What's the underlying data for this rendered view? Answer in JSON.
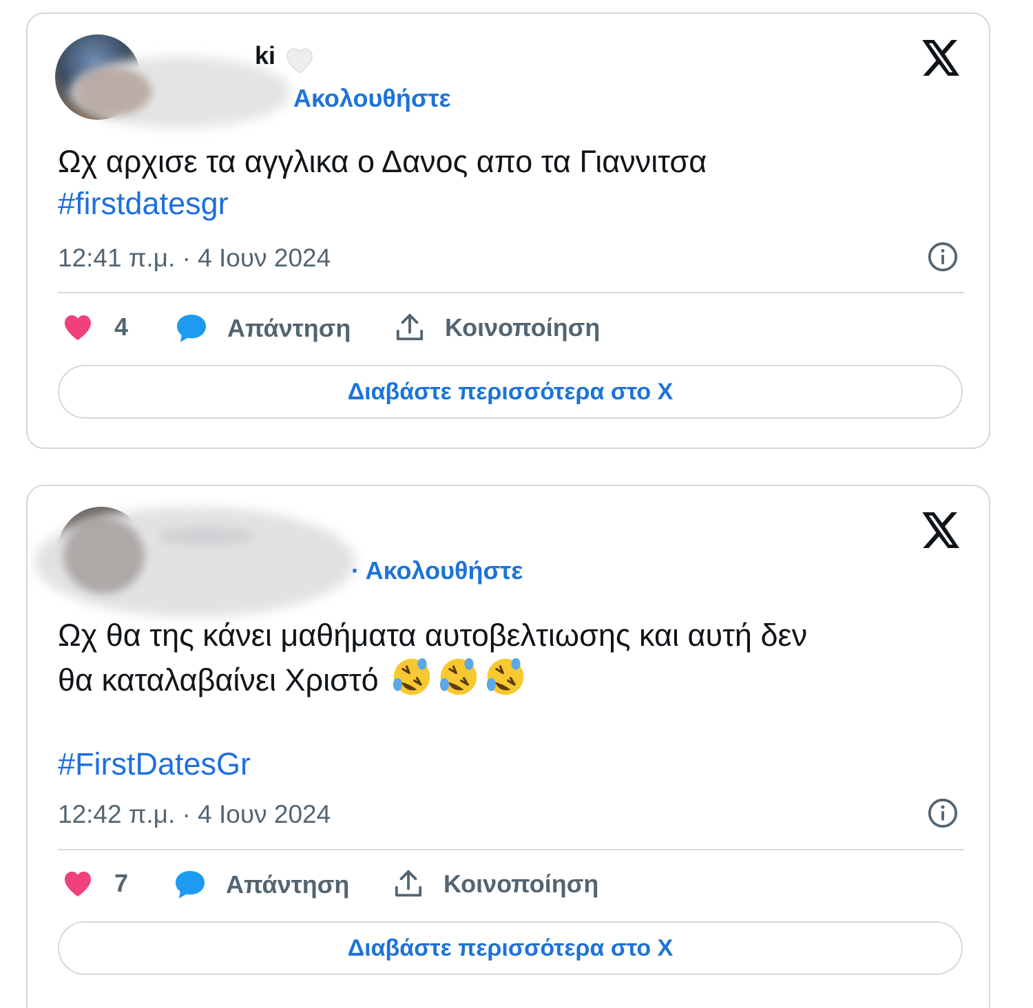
{
  "tweets": [
    {
      "name_partial": "ki",
      "follow_label": "Ακολουθήστε",
      "text_lines": [
        "Ωχ αρχισε τα αγγλικα ο Δανος απο τα Γιαννιτσα"
      ],
      "hashtag": "#firstdatesgr",
      "timestamp": "12:41 π.μ. · 4 Ιουν 2024",
      "likes": "4",
      "reply_label": "Απάντηση",
      "share_label": "Κοινοποίηση",
      "read_more_label": "Διαβάστε περισσότερα στο X"
    },
    {
      "follow_label": "· Ακολουθήστε",
      "text_lines": [
        "Ωχ θα της κάνει μαθήματα αυτοβελτιωσης και αυτή δεν",
        "θα καταλαβαίνει Χριστό"
      ],
      "emoji": [
        "rolling-on-floor-laughing",
        "rolling-on-floor-laughing",
        "rolling-on-floor-laughing"
      ],
      "hashtag": "#FirstDatesGr",
      "timestamp": "12:42 π.μ. · 4 Ιουν 2024",
      "likes": "7",
      "reply_label": "Απάντηση",
      "share_label": "Κοινοποίηση",
      "read_more_label": "Διαβάστε περισσότερα στο X"
    }
  ],
  "colors": {
    "link": "#1d73d8",
    "hashtag": "#1d6fe0",
    "muted": "#536471",
    "like": "#f0417c",
    "reply": "#1d9bf0",
    "border": "#cfd9de"
  }
}
